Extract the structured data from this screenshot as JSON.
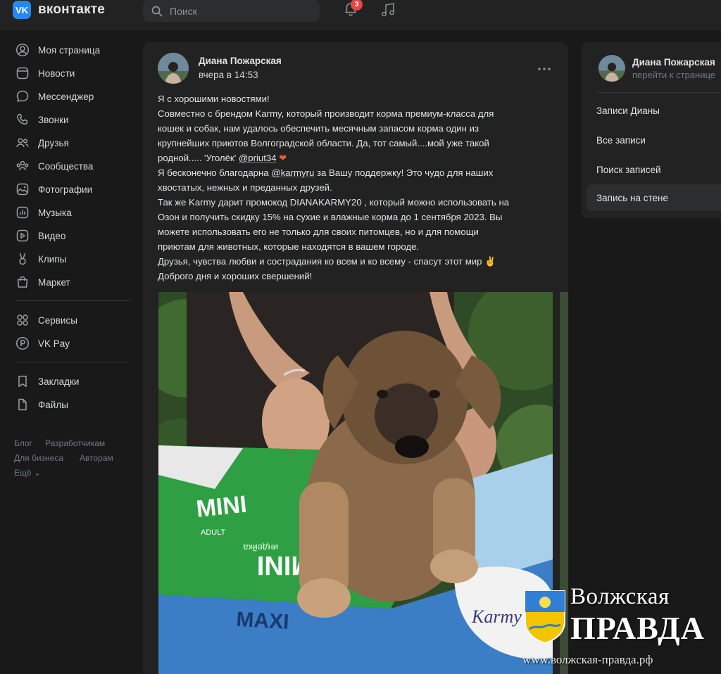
{
  "header": {
    "logo_mark": "VK",
    "logo_text": "вконтакте",
    "search_placeholder": "Поиск",
    "notifications_count": "3",
    "icons": [
      "search-icon",
      "bell-icon",
      "music-icon"
    ]
  },
  "sidebar": {
    "items": [
      {
        "label": "Моя страница",
        "icon": "user-icon"
      },
      {
        "label": "Новости",
        "icon": "news-icon"
      },
      {
        "label": "Мессенджер",
        "icon": "message-icon"
      },
      {
        "label": "Звонки",
        "icon": "phone-icon"
      },
      {
        "label": "Друзья",
        "icon": "friends-icon"
      },
      {
        "label": "Сообщества",
        "icon": "groups-icon"
      },
      {
        "label": "Фотографии",
        "icon": "photo-icon"
      },
      {
        "label": "Музыка",
        "icon": "music-icon"
      },
      {
        "label": "Видео",
        "icon": "video-icon"
      },
      {
        "label": "Клипы",
        "icon": "clips-icon"
      },
      {
        "label": "Маркет",
        "icon": "market-icon"
      }
    ],
    "services": [
      {
        "label": "Сервисы",
        "icon": "services-icon"
      },
      {
        "label": "VK Pay",
        "icon": "vkpay-icon"
      }
    ],
    "saved": [
      {
        "label": "Закладки",
        "icon": "bookmark-icon"
      },
      {
        "label": "Файлы",
        "icon": "file-icon"
      }
    ],
    "footer": {
      "blog": "Блог",
      "developers": "Разработчикам",
      "business": "Для бизнеса",
      "authors": "Авторам",
      "more": "Ещё ⌄"
    }
  },
  "post": {
    "author": "Диана Пожарская",
    "time": "вчера в 14:53",
    "lines": {
      "l1": "Я с хорошими новостями!",
      "l2": "Совместно с брендом Karmy, который производит корма премиум-класса для",
      "l3": "кошек и собак, нам удалось обеспечить месячным запасом корма один из",
      "l4": "крупнейших приютов Волгоградской области. Да, тот самый....мой уже такой",
      "l5a": "родной..... 'Уголёк' ",
      "l5link": "@priut34",
      "l5b": " ❤",
      "l6a": "Я бесконечно благодарна ",
      "l6link": "@karmyru",
      "l6b": " за Вашу поддержку! Это чудо для наших",
      "l7": "хвостатых, нежных и преданных друзей.",
      "l8": "Так же Karmy дарит промокод DIANAKARMY20 , который можно использовать на",
      "l9": "Озон и получить скидку 15% на сухие и влажные корма до 1 сентября 2023. Вы",
      "l10": "можете использовать его не только для своих питомцев, но и для помощи",
      "l11": "приютам для животных, которые находятся в вашем городе.",
      "l12": "Друзья, чувства любви и сострадания ко всем и ко всему - спасут этот мир ✌",
      "l13": "Доброго дня и хороших свершений!"
    },
    "photo_labels": {
      "bag_top": "MINI",
      "bag_sub": "ADULT",
      "bag_flavor": "индейка",
      "bag_main": "MINI",
      "bag_blue": "MAXI",
      "brand": "Karmy"
    }
  },
  "right_panel": {
    "name": "Диана Пожарская",
    "sub": "перейти к странице",
    "items": [
      {
        "label": "Записи Дианы",
        "active": false
      },
      {
        "label": "Все записи",
        "active": false
      },
      {
        "label": "Поиск записей",
        "active": false
      },
      {
        "label": "Запись на стене",
        "active": true
      }
    ]
  },
  "watermark": {
    "line1": "Волжская",
    "line2": "ПРАВДА",
    "line3": "www.волжская-правда.рф"
  }
}
